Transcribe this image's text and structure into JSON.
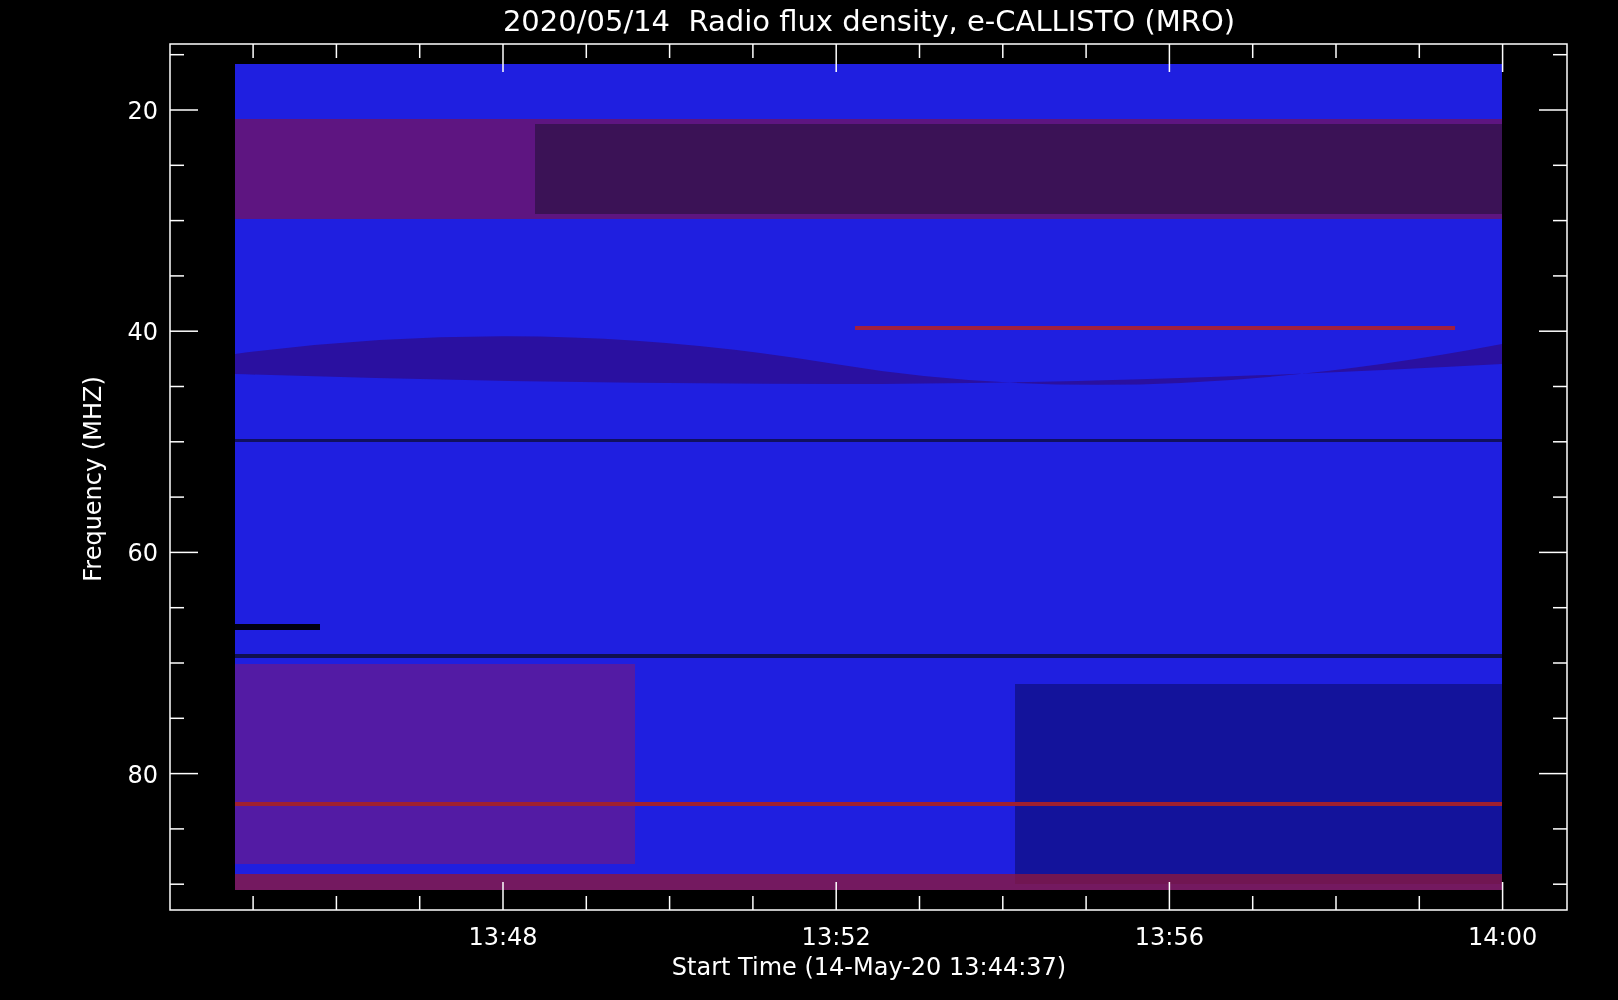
{
  "title": "2020/05/14  Radio flux density, e-CALLISTO (MRO)",
  "y_axis": {
    "label": "Frequency (MHZ)",
    "ticks": [
      "20",
      "40",
      "60",
      "80"
    ]
  },
  "x_axis": {
    "label": "Start Time (14-May-20 13:44:37)",
    "ticks": [
      "13:48",
      "13:52",
      "13:56",
      "14:00"
    ]
  }
}
